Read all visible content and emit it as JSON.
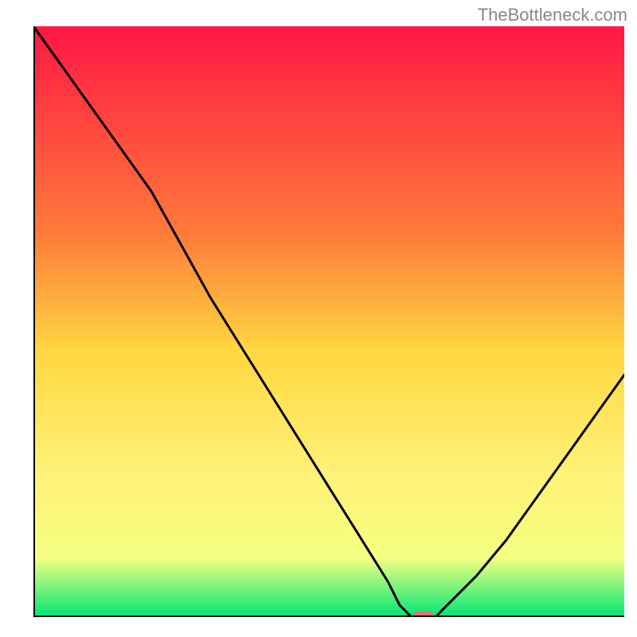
{
  "watermark": "TheBottleneck.com",
  "chart_data": {
    "type": "line",
    "title": "",
    "xlabel": "",
    "ylabel": "",
    "xlim": [
      0,
      100
    ],
    "ylim": [
      0,
      100
    ],
    "series": [
      {
        "name": "curve",
        "x": [
          0,
          5,
          10,
          15,
          20,
          25,
          30,
          35,
          40,
          45,
          50,
          55,
          60,
          62,
          64,
          66,
          68,
          70,
          75,
          80,
          85,
          90,
          95,
          100
        ],
        "y": [
          100,
          93,
          86,
          79,
          72,
          63,
          54,
          46,
          38,
          30,
          22,
          14,
          6,
          2,
          0,
          0,
          0,
          2,
          7,
          13,
          20,
          27,
          34,
          41
        ]
      }
    ],
    "marker": {
      "x": 66,
      "y": 0,
      "color": "#e36f6f"
    },
    "gradient_stops": [
      {
        "offset": 0.0,
        "color": "#ff1744"
      },
      {
        "offset": 0.35,
        "color": "#ff7a3a"
      },
      {
        "offset": 0.55,
        "color": "#ffd740"
      },
      {
        "offset": 0.75,
        "color": "#fff176"
      },
      {
        "offset": 0.9,
        "color": "#f4ff81"
      },
      {
        "offset": 1.0,
        "color": "#00e676"
      }
    ]
  }
}
